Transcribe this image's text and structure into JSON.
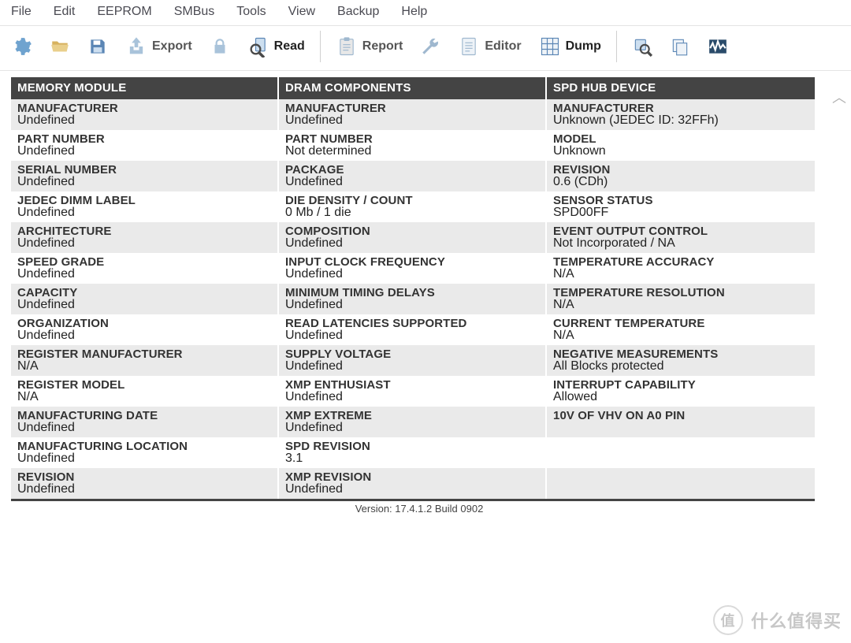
{
  "menu": [
    "File",
    "Edit",
    "EEPROM",
    "SMBus",
    "Tools",
    "View",
    "Backup",
    "Help"
  ],
  "toolbar": {
    "export": "Export",
    "read": "Read",
    "report": "Report",
    "editor": "Editor",
    "dump": "Dump"
  },
  "columns": [
    {
      "title": "MEMORY MODULE",
      "rows": [
        {
          "label": "MANUFACTURER",
          "value": "Undefined"
        },
        {
          "label": "PART NUMBER",
          "value": "Undefined"
        },
        {
          "label": "SERIAL NUMBER",
          "value": "Undefined"
        },
        {
          "label": "JEDEC DIMM LABEL",
          "value": "Undefined"
        },
        {
          "label": "ARCHITECTURE",
          "value": "Undefined"
        },
        {
          "label": "SPEED GRADE",
          "value": "Undefined"
        },
        {
          "label": "CAPACITY",
          "value": "Undefined"
        },
        {
          "label": "ORGANIZATION",
          "value": "Undefined"
        },
        {
          "label": "REGISTER MANUFACTURER",
          "value": "N/A"
        },
        {
          "label": "REGISTER MODEL",
          "value": "N/A"
        },
        {
          "label": "MANUFACTURING DATE",
          "value": "Undefined"
        },
        {
          "label": "MANUFACTURING LOCATION",
          "value": "Undefined"
        },
        {
          "label": "REVISION",
          "value": "Undefined"
        }
      ]
    },
    {
      "title": "DRAM COMPONENTS",
      "rows": [
        {
          "label": "MANUFACTURER",
          "value": "Undefined"
        },
        {
          "label": "PART NUMBER",
          "value": "Not determined"
        },
        {
          "label": "PACKAGE",
          "value": "Undefined"
        },
        {
          "label": "DIE DENSITY / COUNT",
          "value": "0 Mb / 1 die"
        },
        {
          "label": "COMPOSITION",
          "value": "Undefined"
        },
        {
          "label": "INPUT CLOCK FREQUENCY",
          "value": "Undefined"
        },
        {
          "label": "MINIMUM TIMING DELAYS",
          "value": "Undefined"
        },
        {
          "label": "READ LATENCIES SUPPORTED",
          "value": "Undefined"
        },
        {
          "label": "SUPPLY VOLTAGE",
          "value": "Undefined"
        },
        {
          "label": "XMP ENTHUSIAST",
          "value": "Undefined"
        },
        {
          "label": "XMP EXTREME",
          "value": "Undefined"
        },
        {
          "label": "SPD REVISION",
          "value": "3.1"
        },
        {
          "label": "XMP REVISION",
          "value": "Undefined"
        }
      ]
    },
    {
      "title": "SPD HUB DEVICE",
      "rows": [
        {
          "label": "MANUFACTURER",
          "value": "Unknown (JEDEC ID: 32FFh)"
        },
        {
          "label": "MODEL",
          "value": "Unknown"
        },
        {
          "label": "REVISION",
          "value": "0.6 (CDh)"
        },
        {
          "label": "SENSOR STATUS",
          "value": "SPD00FF"
        },
        {
          "label": "EVENT OUTPUT CONTROL",
          "value": "Not Incorporated / NA"
        },
        {
          "label": "TEMPERATURE ACCURACY",
          "value": "N/A"
        },
        {
          "label": "TEMPERATURE RESOLUTION",
          "value": "N/A"
        },
        {
          "label": "CURRENT TEMPERATURE",
          "value": "N/A"
        },
        {
          "label": "NEGATIVE MEASUREMENTS",
          "value": "All Blocks protected"
        },
        {
          "label": "INTERRUPT CAPABILITY",
          "value": "Allowed"
        },
        {
          "label": "10V OF VHV ON A0 PIN",
          "value": ""
        },
        {
          "label": "",
          "value": "",
          "empty": true
        },
        {
          "label": "",
          "value": "",
          "empty": true
        }
      ]
    }
  ],
  "version": "Version: 17.4.1.2 Build 0902",
  "watermark": {
    "badge": "值",
    "text": "什么值得买"
  }
}
